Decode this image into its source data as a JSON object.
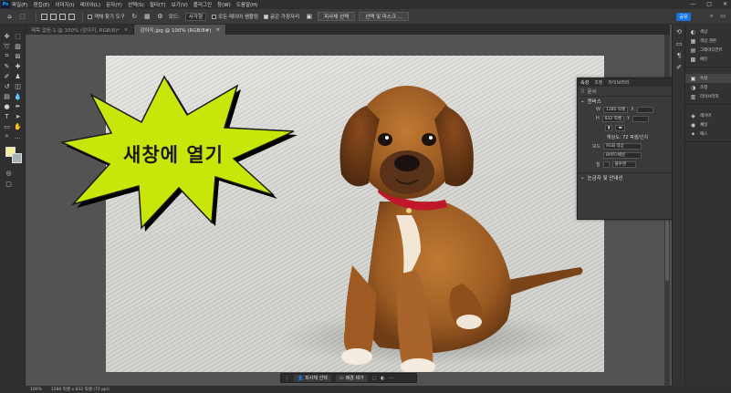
{
  "menubar": {
    "logo": "Ps",
    "items": [
      "파일(F)",
      "편집(E)",
      "이미지(I)",
      "레이어(L)",
      "문자(Y)",
      "선택(S)",
      "필터(T)",
      "보기(V)",
      "플러그인",
      "창(W)",
      "도움말(H)"
    ]
  },
  "window_controls": [
    "—",
    "□",
    "✕"
  ],
  "options": {
    "sample_all_layers": "객체 찾기 도구",
    "mode_label": "모드:",
    "mode_value": "사각형",
    "all_layers_sample": "모든 레이어 샘플링",
    "enhance_edge": "굵은 가장자리",
    "select_subject": "피사체 선택",
    "select_and_mask": "선택 및 마스크 ..."
  },
  "share_button": "공유",
  "tabs": [
    {
      "label": "제목 없음-1 @ 100% (감아지, RGB/8)*",
      "close": "×"
    },
    {
      "label": "강아지.jpg @ 100% (RGB/8#)",
      "close": "×"
    }
  ],
  "callout_text": "새창에 열기",
  "properties_panel": {
    "tabs": [
      "속성",
      "조정",
      "라이브러리"
    ],
    "doc_label": "문서",
    "canvas_section": "캔버스",
    "width_label": "W",
    "width_value": "1280 픽셀",
    "height_label": "H",
    "height_value": "832 픽셀",
    "x_label": "X",
    "y_label": "Y",
    "resolution": "해상도: 72 픽셀/인치",
    "mode_label": "모드",
    "mode_value": "RGB 색상",
    "bit_value": "8비트/채널",
    "fill_label": "칠",
    "fill_value": "불투명",
    "rulers_section": "눈금자 및 안내선"
  },
  "dock": {
    "group1": [
      "색상",
      "색상 견본",
      "그레이디언트",
      "패턴"
    ],
    "group2": [
      "속성",
      "조정",
      "라이브러리"
    ],
    "group3": [
      "레이어",
      "채널",
      "패스"
    ]
  },
  "taskbar": {
    "select_subject": "피사체 선택",
    "remove_bg": "배경 제거"
  },
  "status": {
    "zoom": "100%",
    "doc_info": "1280 픽셀 x 832 픽셀 (72 ppi)"
  },
  "colors": {
    "foreground": "#f1eea0",
    "background": "#a4b3b3",
    "starburst_fill": "#c8e60a",
    "accent": "#1473e6"
  }
}
